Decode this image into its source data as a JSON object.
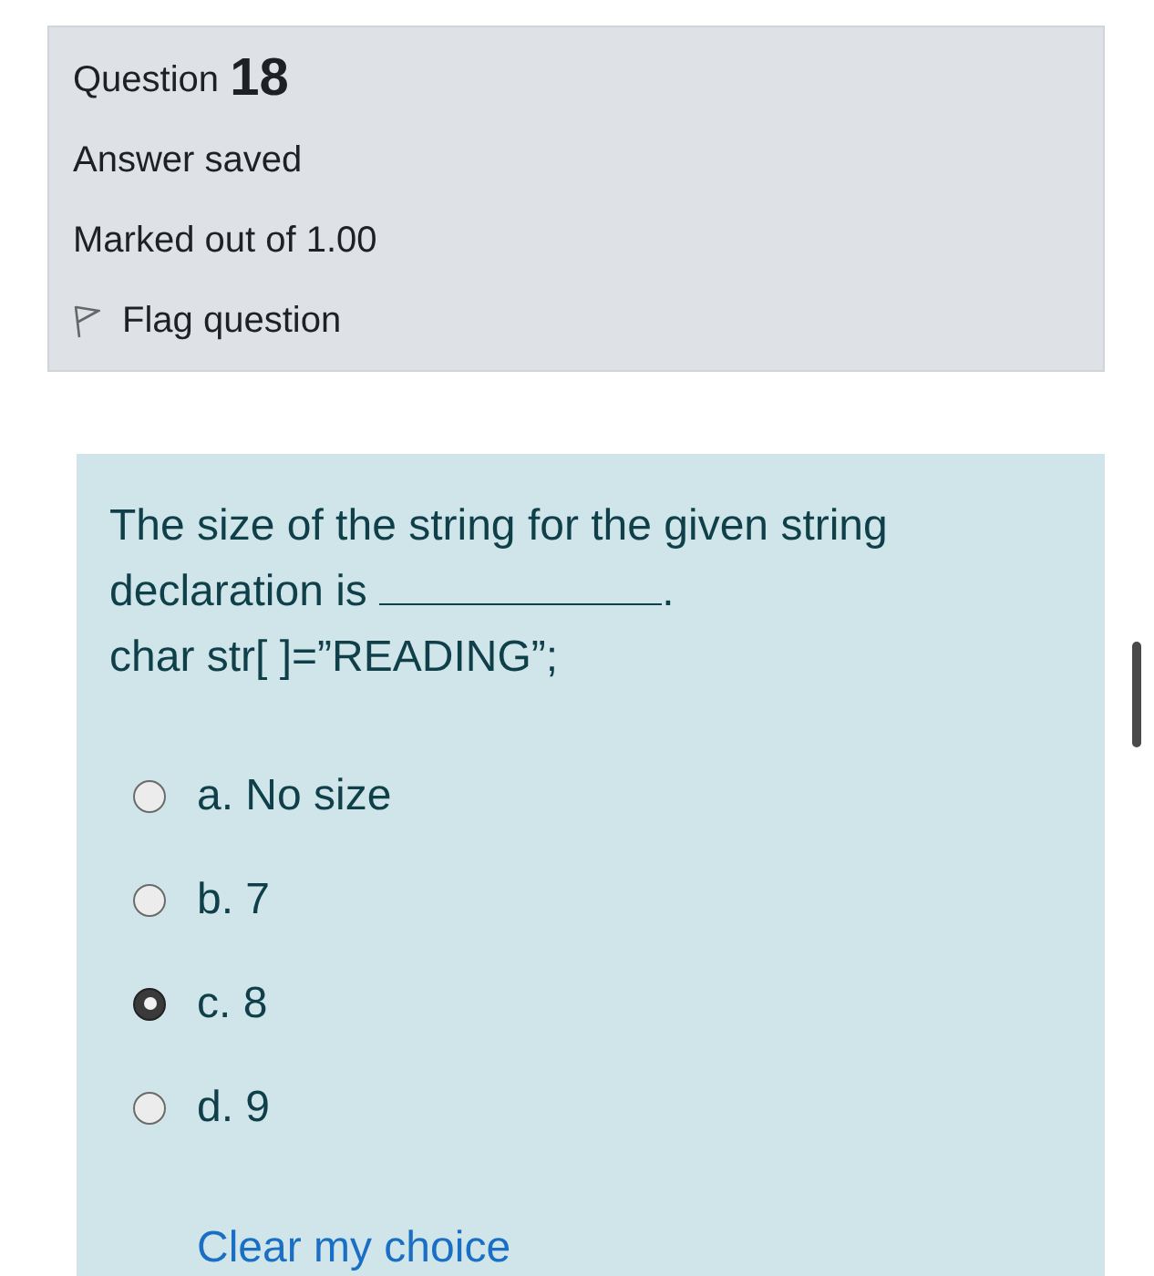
{
  "info": {
    "label": "Question",
    "number": "18",
    "state": "Answer saved",
    "grade": "Marked out of 1.00",
    "flag": "Flag question"
  },
  "question": {
    "text": "The size of the string for the given string declaration is",
    "after_blank": ".",
    "code": "char str[ ]=”READING”;"
  },
  "options": [
    {
      "label": "a. No size",
      "selected": false
    },
    {
      "label": "b. 7",
      "selected": false
    },
    {
      "label": "c. 8",
      "selected": true
    },
    {
      "label": "d. 9",
      "selected": false
    }
  ],
  "clear_link": "Clear my choice"
}
